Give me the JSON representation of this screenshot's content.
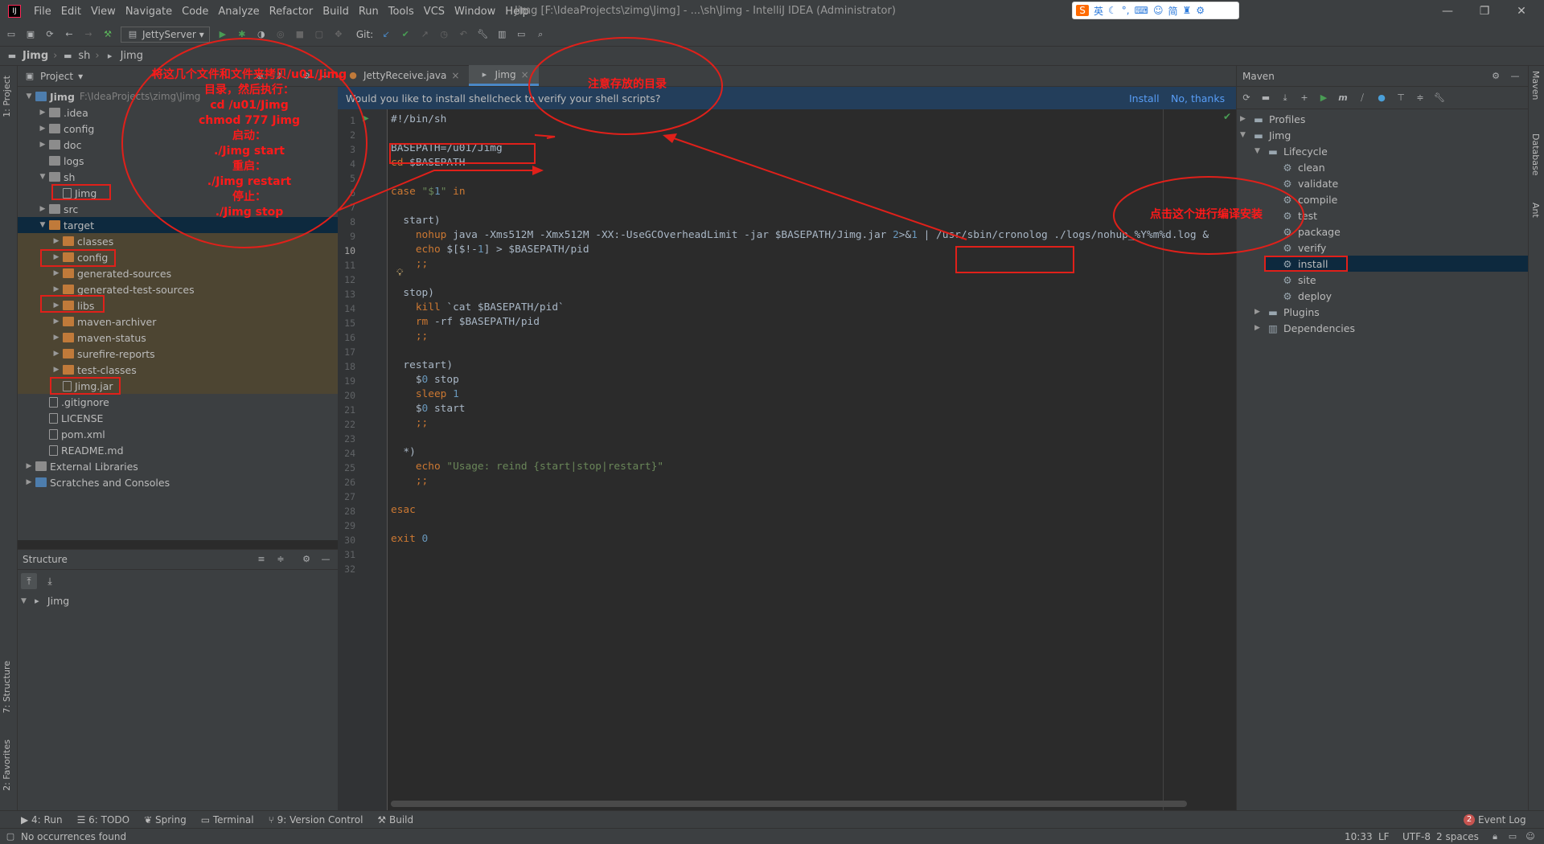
{
  "menubar": {
    "items": [
      "File",
      "Edit",
      "View",
      "Navigate",
      "Code",
      "Analyze",
      "Refactor",
      "Build",
      "Run",
      "Tools",
      "VCS",
      "Window",
      "Help"
    ],
    "window_title": "Jimg [F:\\IdeaProjects\\zimg\\Jimg] - ...\\sh\\Jimg - IntelliJ IDEA (Administrator)",
    "ime": [
      "英",
      "简"
    ]
  },
  "toolbar": {
    "run_config": "JettyServer",
    "git_label": "Git:"
  },
  "breadcrumb": [
    "Jimg",
    "sh",
    "Jimg"
  ],
  "project": {
    "header": "Project",
    "rows": [
      {
        "label": "Jimg",
        "path": "F:\\IdeaProjects\\zimg\\Jimg",
        "arrow": "▼",
        "depth": 0,
        "type": "blue"
      },
      {
        "label": ".idea",
        "arrow": "▶",
        "depth": 1,
        "type": "grey"
      },
      {
        "label": "config",
        "arrow": "▶",
        "depth": 1,
        "type": "grey"
      },
      {
        "label": "doc",
        "arrow": "▶",
        "depth": 1,
        "type": "grey"
      },
      {
        "label": "logs",
        "arrow": "",
        "depth": 1,
        "type": "grey"
      },
      {
        "label": "sh",
        "arrow": "▼",
        "depth": 1,
        "type": "grey"
      },
      {
        "label": "Jimg",
        "arrow": "",
        "depth": 2,
        "type": "file"
      },
      {
        "label": "src",
        "arrow": "▶",
        "depth": 1,
        "type": "grey"
      },
      {
        "label": "target",
        "arrow": "▼",
        "depth": 1,
        "type": "orange",
        "sel": true
      },
      {
        "label": "classes",
        "arrow": "▶",
        "depth": 2,
        "type": "orange",
        "tint": true
      },
      {
        "label": "config",
        "arrow": "▶",
        "depth": 2,
        "type": "orange",
        "tint": true
      },
      {
        "label": "generated-sources",
        "arrow": "▶",
        "depth": 2,
        "type": "orange",
        "tint": true
      },
      {
        "label": "generated-test-sources",
        "arrow": "▶",
        "depth": 2,
        "type": "orange",
        "tint": true
      },
      {
        "label": "libs",
        "arrow": "▶",
        "depth": 2,
        "type": "orange",
        "tint": true
      },
      {
        "label": "maven-archiver",
        "arrow": "▶",
        "depth": 2,
        "type": "orange",
        "tint": true
      },
      {
        "label": "maven-status",
        "arrow": "▶",
        "depth": 2,
        "type": "orange",
        "tint": true
      },
      {
        "label": "surefire-reports",
        "arrow": "▶",
        "depth": 2,
        "type": "orange",
        "tint": true
      },
      {
        "label": "test-classes",
        "arrow": "▶",
        "depth": 2,
        "type": "orange",
        "tint": true
      },
      {
        "label": "Jimg.jar",
        "arrow": "",
        "depth": 2,
        "type": "file",
        "tint": true
      },
      {
        "label": ".gitignore",
        "arrow": "",
        "depth": 1,
        "type": "file"
      },
      {
        "label": "LICENSE",
        "arrow": "",
        "depth": 1,
        "type": "file"
      },
      {
        "label": "pom.xml",
        "arrow": "",
        "depth": 1,
        "type": "file"
      },
      {
        "label": "README.md",
        "arrow": "",
        "depth": 1,
        "type": "file"
      },
      {
        "label": "External Libraries",
        "arrow": "▶",
        "depth": 0,
        "type": "grey"
      },
      {
        "label": "Scratches and Consoles",
        "arrow": "▶",
        "depth": 0,
        "type": "blue"
      }
    ]
  },
  "structure": {
    "header": "Structure",
    "root": "Jimg"
  },
  "editor": {
    "tabs": [
      "JettyReceive.java",
      "Jimg"
    ],
    "notice": "Would you like to install shellcheck to verify your shell scripts?",
    "notice_install": "Install",
    "notice_no": "No, thanks",
    "lines": [
      "#!/bin/sh",
      "",
      "BASEPATH=/u01/Jimg",
      "cd $BASEPATH",
      "",
      "case \"$1\" in",
      "",
      "  start)",
      "    nohup java -Xms512M -Xmx512M -XX:-UseGCOverheadLimit -jar $BASEPATH/Jimg.jar 2>&1 | /usr/sbin/cronolog ./logs/nohup_%Y%m%d.log &",
      "    echo $[$!-1] > $BASEPATH/pid",
      "    ;;",
      "",
      "  stop)",
      "    kill `cat $BASEPATH/pid`",
      "    rm -rf $BASEPATH/pid",
      "    ;;",
      "",
      "  restart)",
      "    $0 stop",
      "    sleep 1",
      "    $0 start",
      "    ;;",
      "",
      "  *)",
      "    echo \"Usage: reind {start|stop|restart}\"",
      "    ;;",
      "",
      "esac",
      "",
      "exit 0",
      "",
      ""
    ]
  },
  "maven": {
    "header": "Maven",
    "profiles": "Profiles",
    "project": "Jimg",
    "lifecycle": "Lifecycle",
    "goals": [
      "clean",
      "validate",
      "compile",
      "test",
      "package",
      "verify",
      "install",
      "site",
      "deploy"
    ],
    "plugins": "Plugins",
    "dependencies": "Dependencies"
  },
  "side_tabs": {
    "left": [
      "1: Project",
      "7: Structure",
      "2: Favorites"
    ],
    "right": [
      "Maven",
      "Database",
      "Ant"
    ]
  },
  "bottom_tools": [
    "4: Run",
    "6: TODO",
    "Spring",
    "Terminal",
    "9: Version Control",
    "Build"
  ],
  "event_log": {
    "count": "2",
    "label": "Event Log"
  },
  "status": {
    "message": "No occurrences found",
    "position": "10:33",
    "line_sep": "LF",
    "encoding": "UTF-8",
    "indent": "2 spaces"
  },
  "annotations": {
    "copy_note": [
      "将这几个文件和文件夹拷贝/u01/Jimg",
      "目录，然后执行：",
      "cd /u01/Jimg",
      "chmod 777 Jimg",
      "启动：",
      "./Jimg start",
      "重启：",
      "./Jimg restart",
      "停止：",
      "./Jimg stop"
    ],
    "dir_note": "注意存放的目录",
    "install_note": "点击这个进行编译安装"
  }
}
